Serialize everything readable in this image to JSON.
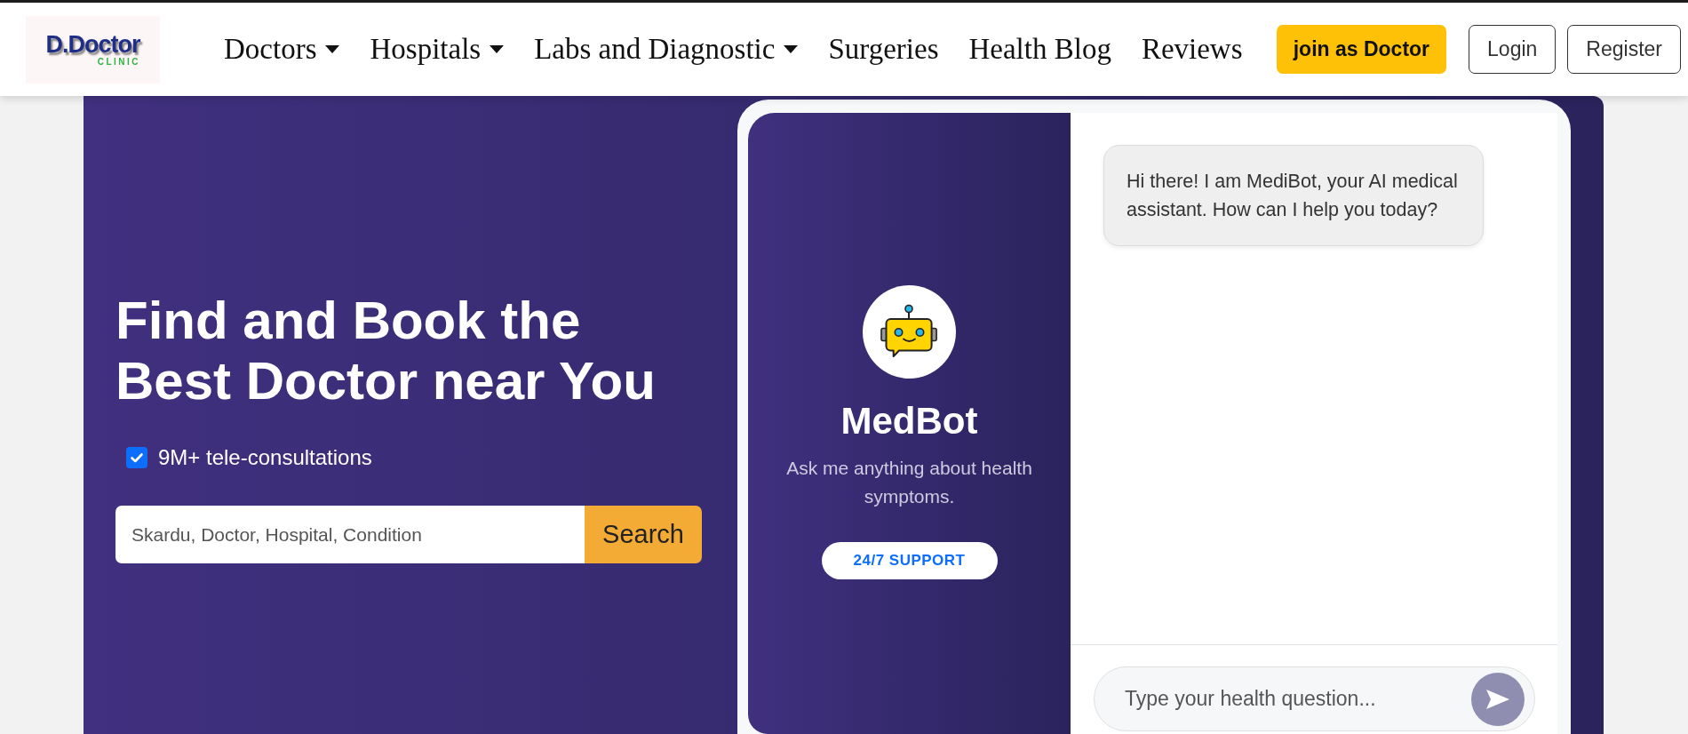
{
  "navbar": {
    "logo": {
      "wordmark": "D.Doctor",
      "tagline": "CLINIC"
    },
    "menu": [
      {
        "label": "Doctors",
        "dropdown": true
      },
      {
        "label": "Hospitals",
        "dropdown": true
      },
      {
        "label": "Labs and Diagnostic",
        "dropdown": true
      },
      {
        "label": "Surgeries",
        "dropdown": false
      },
      {
        "label": "Health Blog",
        "dropdown": false
      },
      {
        "label": "Reviews",
        "dropdown": false
      }
    ],
    "buttons": [
      {
        "label": "join as Doctor",
        "kind": "primary"
      },
      {
        "label": "Login",
        "kind": "outline"
      },
      {
        "label": "Register",
        "kind": "outline"
      }
    ]
  },
  "hero": {
    "heading": [
      "Find and Book the",
      "Best Doctor near You"
    ],
    "feature": {
      "label": "9M+ tele-consultations",
      "checked": true
    },
    "search": {
      "placeholder": "Skardu, Doctor, Hospital, Condition",
      "button": "Search"
    }
  },
  "chatbot": {
    "name": "MedBot",
    "tagline": "Ask me anything about health symptoms.",
    "badge": "24/7 SUPPORT",
    "messages": [
      {
        "kind": "bot",
        "text": "Hi there! I am MediBot, your AI medical assistant. How can I help you today?"
      }
    ],
    "input": {
      "placeholder": "Type your health question..."
    }
  }
}
